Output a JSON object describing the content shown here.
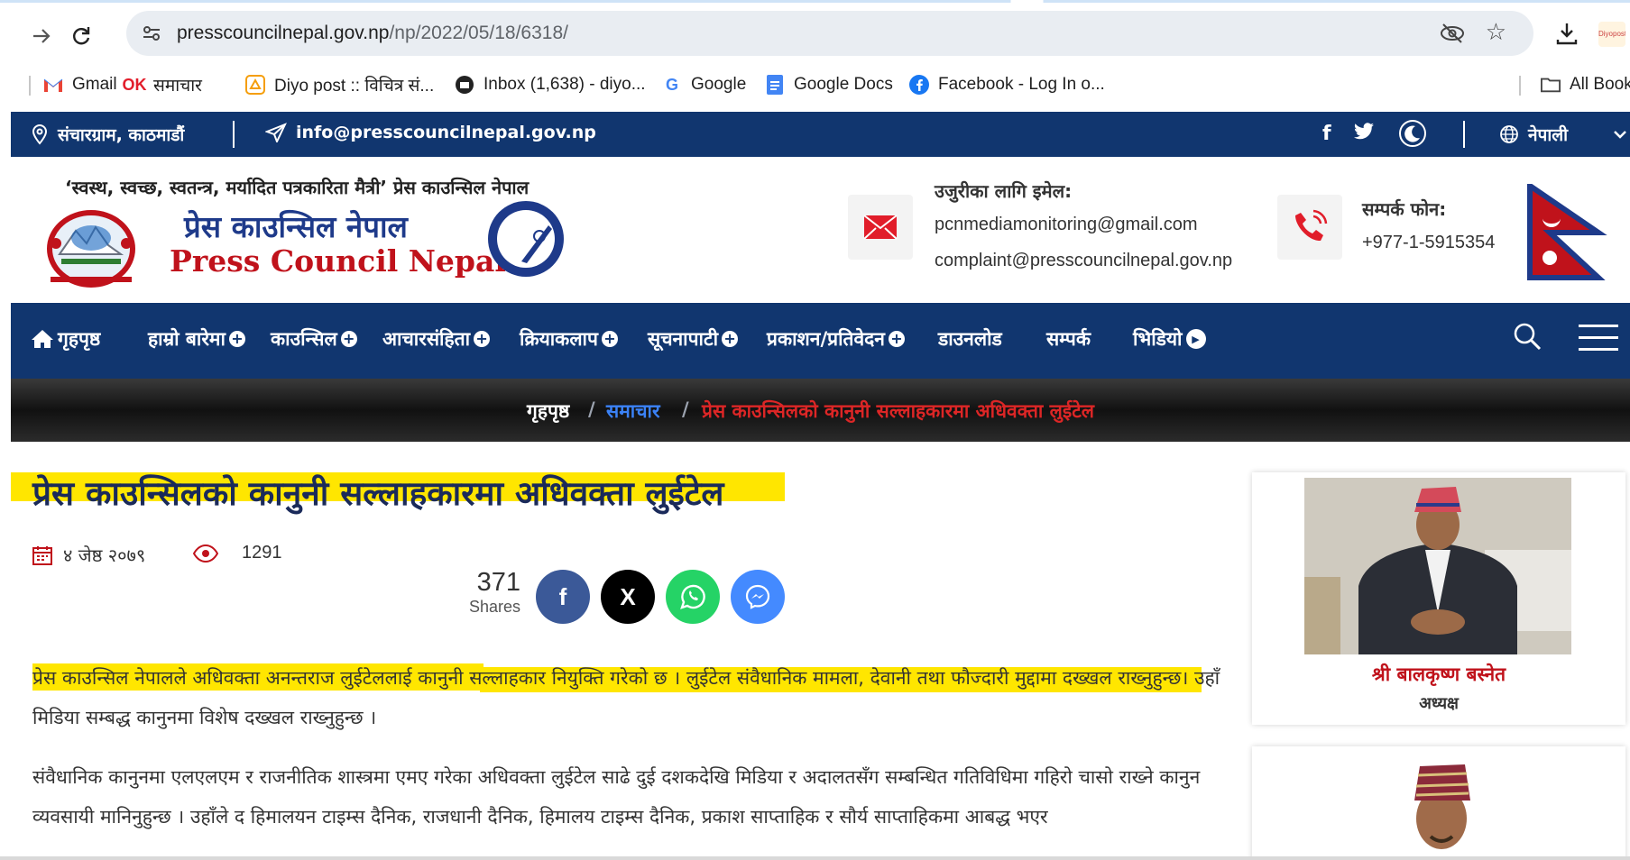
{
  "browser": {
    "url_host": "presscouncilnepal.gov.np",
    "url_path": "/np/2022/05/18/6318/",
    "extension_label": "Diyopost",
    "bookmarks": [
      {
        "label": "Gmail",
        "icon": "gmail-icon"
      },
      {
        "label": "समाचार",
        "icon": "ok-icon"
      },
      {
        "label": "Diyo post :: विचित्र सं...",
        "icon": "diyopost-icon"
      },
      {
        "label": "Inbox (1,638) - diyo...",
        "icon": "mail-icon"
      },
      {
        "label": "Google",
        "icon": "google-icon"
      },
      {
        "label": "Google Docs",
        "icon": "docs-icon"
      },
      {
        "label": "Facebook - Log In o...",
        "icon": "facebook-icon"
      },
      {
        "label": "All Book",
        "icon": "folder-icon"
      }
    ]
  },
  "topbar": {
    "address": "संचारग्राम, काठमाडौं",
    "email": "info@presscouncilnepal.gov.np",
    "language": "नेपाली"
  },
  "header": {
    "tagline": "‘स्वस्थ, स्वच्छ, स्वतन्त्र, मर्यादित पत्रकारिता मैत्री’ प्रेस काउन्सिल नेपाल",
    "logo_np": "प्रेस काउन्सिल नेपाल",
    "logo_en": "Press Council Nepal",
    "complaint_heading": "उजुरीका लागि इमेल:",
    "complaint_email_1": "pcnmediamonitoring@gmail.com",
    "complaint_email_2": "complaint@presscouncilnepal.gov.np",
    "phone_heading": "सम्पर्क फोन:",
    "phone": "+977-1-5915354"
  },
  "nav": {
    "home": "गृहपृष्ठ",
    "about": "हाम्रो बारेमा",
    "council": "काउन्सिल",
    "code": "आचारसंहिता",
    "activities": "क्रियाकलाप",
    "notice": "सूचनापाटी",
    "publication": "प्रकाशन/प्रतिवेदन",
    "download": "डाउनलोड",
    "contact": "सम्पर्क",
    "video": "भिडियो"
  },
  "breadcrumb": {
    "home": "गृहपृष्ठ",
    "sep": "/",
    "category": "समाचार",
    "current": "प्रेस काउन्सिलको कानुनी सल्लाहकारमा अधिवक्ता लुईटेल"
  },
  "article": {
    "title": "प्रेस काउन्सिलको कानुनी सल्लाहकारमा अधिवक्ता लुईटेल",
    "date": "४ जेष्ठ २०७९",
    "views": "1291",
    "share_count": "371",
    "share_label": "Shares",
    "para1": "प्रेस काउन्सिल नेपालले अधिवक्ता अनन्तराज लुईटेललाई कानुनी सल्लाहकार नियुक्ति गरेको छ । लुईटेल संवैधानिक मामला, देवानी तथा फौज्दारी मुद्दामा दख्खल राख्नुहुन्छ। उहाँ मिडिया सम्बद्ध कानुनमा विशेष दख्खल राख्नुहुन्छ ।",
    "para2": "संवैधानिक कानुनमा एलएलएम र राजनीतिक शास्त्रमा एमए गरेका अधिवक्ता लुईटेल साढे दुई दशकदेखि मिडिया र अदालतसँग सम्बन्धित गतिविधिमा गहिरो चासो राख्ने कानुन व्यवसायी मानिनुहुन्छ । उहाँले द हिमालयन टाइम्स दैनिक, राजधानी दैनिक, हिमालय टाइम्स दैनिक, प्रकाश साप्ताहिक र सौर्य साप्ताहिकमा आबद्ध भएर"
  },
  "sidebar": {
    "chair_name": "श्री बालकृष्ण बस्नेत",
    "chair_role": "अध्यक्ष"
  },
  "colors": {
    "navy": "#11366f",
    "highlight": "#ffe600",
    "red": "#c0121b",
    "facebook": "#3b5998",
    "x": "#000000",
    "whatsapp": "#25d366",
    "messenger": "#448aff"
  }
}
